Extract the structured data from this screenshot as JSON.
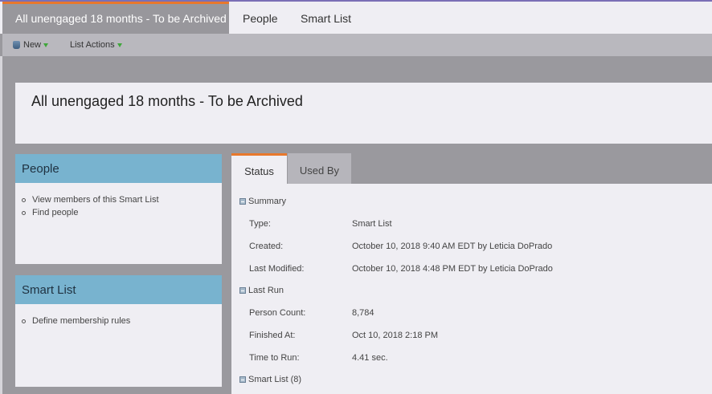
{
  "top_tabs": {
    "active": "All unengaged 18 months - To be Archived",
    "people": "People",
    "smart_list": "Smart List"
  },
  "toolbar": {
    "new_label": "New",
    "list_actions_label": "List Actions"
  },
  "header": {
    "title": "All unengaged 18 months - To be Archived"
  },
  "people_box": {
    "title": "People",
    "items": [
      "View members of this Smart List",
      "Find people"
    ]
  },
  "smart_list_box": {
    "title": "Smart List",
    "items": [
      "Define membership rules"
    ]
  },
  "detail_tabs": {
    "status": "Status",
    "used_by": "Used By"
  },
  "summary": {
    "heading": "Summary",
    "type_label": "Type:",
    "type_value": "Smart List",
    "created_label": "Created:",
    "created_value": "October 10, 2018 9:40 AM EDT by Leticia DoPrado",
    "modified_label": "Last Modified:",
    "modified_value": "October 10, 2018 4:48 PM EDT by Leticia DoPrado"
  },
  "last_run": {
    "heading": "Last Run",
    "count_label": "Person Count:",
    "count_value": "8,784",
    "finished_label": "Finished At:",
    "finished_value": "Oct 10, 2018 2:18 PM",
    "time_label": "Time to Run:",
    "time_value": "4.41 sec."
  },
  "smart_list_section": {
    "heading": "Smart List (8)"
  },
  "colors": {
    "accent_orange": "#e8782c",
    "panel_blue": "#78b3cf",
    "top_border_purple": "#7a6fb5"
  }
}
